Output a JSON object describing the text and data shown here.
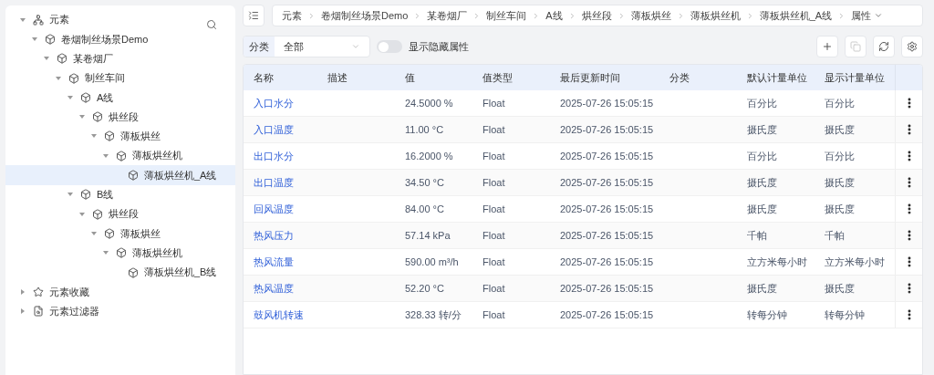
{
  "sidebar": {
    "tree": [
      {
        "label": "元素",
        "kind": "root",
        "expanded": true,
        "selected": false,
        "children": [
          {
            "label": "卷烟制丝场景Demo",
            "kind": "element",
            "expanded": true,
            "selected": false,
            "children": [
              {
                "label": "某卷烟厂",
                "kind": "element",
                "expanded": true,
                "selected": false,
                "children": [
                  {
                    "label": "制丝车间",
                    "kind": "element",
                    "expanded": true,
                    "selected": false,
                    "children": [
                      {
                        "label": "A线",
                        "kind": "element",
                        "expanded": true,
                        "selected": false,
                        "children": [
                          {
                            "label": "烘丝段",
                            "kind": "element",
                            "expanded": true,
                            "selected": false,
                            "children": [
                              {
                                "label": "薄板烘丝",
                                "kind": "element",
                                "expanded": true,
                                "selected": false,
                                "children": [
                                  {
                                    "label": "薄板烘丝机",
                                    "kind": "element",
                                    "expanded": true,
                                    "selected": false,
                                    "children": [
                                      {
                                        "label": "薄板烘丝机_A线",
                                        "kind": "element",
                                        "selected": true
                                      }
                                    ]
                                  }
                                ]
                              }
                            ]
                          }
                        ]
                      },
                      {
                        "label": "B线",
                        "kind": "element",
                        "expanded": true,
                        "selected": false,
                        "children": [
                          {
                            "label": "烘丝段",
                            "kind": "element",
                            "expanded": true,
                            "selected": false,
                            "children": [
                              {
                                "label": "薄板烘丝",
                                "kind": "element",
                                "expanded": true,
                                "selected": false,
                                "children": [
                                  {
                                    "label": "薄板烘丝机",
                                    "kind": "element",
                                    "expanded": true,
                                    "selected": false,
                                    "children": [
                                      {
                                        "label": "薄板烘丝机_B线",
                                        "kind": "element",
                                        "selected": false
                                      }
                                    ]
                                  }
                                ]
                              }
                            ]
                          }
                        ]
                      }
                    ]
                  }
                ]
              }
            ]
          }
        ]
      },
      {
        "label": "元素收藏",
        "kind": "favorites",
        "expanded": false,
        "selected": false
      },
      {
        "label": "元素过滤器",
        "kind": "filter",
        "expanded": false,
        "selected": false
      }
    ]
  },
  "breadcrumb": [
    {
      "label": "元素"
    },
    {
      "label": "卷烟制丝场景Demo"
    },
    {
      "label": "某卷烟厂"
    },
    {
      "label": "制丝车间"
    },
    {
      "label": "A线"
    },
    {
      "label": "烘丝段"
    },
    {
      "label": "薄板烘丝"
    },
    {
      "label": "薄板烘丝机"
    },
    {
      "label": "薄板烘丝机_A线"
    },
    {
      "label": "属性",
      "dropdown": true
    }
  ],
  "filter": {
    "label": "分类",
    "value": "全部"
  },
  "hidden_toggle": {
    "label": "显示隐藏属性",
    "on": false
  },
  "toolbar": [
    {
      "kind": "add",
      "disabled": false
    },
    {
      "kind": "copy",
      "disabled": true
    },
    {
      "kind": "refresh",
      "disabled": false
    },
    {
      "kind": "settings",
      "disabled": false
    }
  ],
  "table": {
    "columns": [
      "名称",
      "描述",
      "值",
      "值类型",
      "最后更新时间",
      "分类",
      "默认计量单位",
      "显示计量单位"
    ],
    "rows": [
      [
        "入口水分",
        "",
        "24.5000 %",
        "Float",
        "2025-07-26 15:05:15",
        "",
        "百分比",
        "百分比"
      ],
      [
        "入口温度",
        "",
        "11.00 °C",
        "Float",
        "2025-07-26 15:05:15",
        "",
        "摄氏度",
        "摄氏度"
      ],
      [
        "出口水分",
        "",
        "16.2000 %",
        "Float",
        "2025-07-26 15:05:15",
        "",
        "百分比",
        "百分比"
      ],
      [
        "出口温度",
        "",
        "34.50 °C",
        "Float",
        "2025-07-26 15:05:15",
        "",
        "摄氏度",
        "摄氏度"
      ],
      [
        "回风温度",
        "",
        "84.00 °C",
        "Float",
        "2025-07-26 15:05:15",
        "",
        "摄氏度",
        "摄氏度"
      ],
      [
        "热风压力",
        "",
        "57.14 kPa",
        "Float",
        "2025-07-26 15:05:15",
        "",
        "千帕",
        "千帕"
      ],
      [
        "热风流量",
        "",
        "590.00 m³/h",
        "Float",
        "2025-07-26 15:05:15",
        "",
        "立方米每小时",
        "立方米每小时"
      ],
      [
        "热风温度",
        "",
        "52.20 °C",
        "Float",
        "2025-07-26 15:05:15",
        "",
        "摄氏度",
        "摄氏度"
      ],
      [
        "鼓风机转速",
        "",
        "328.33 转/分",
        "Float",
        "2025-07-26 15:05:15",
        "",
        "转每分钟",
        "转每分钟"
      ]
    ]
  }
}
